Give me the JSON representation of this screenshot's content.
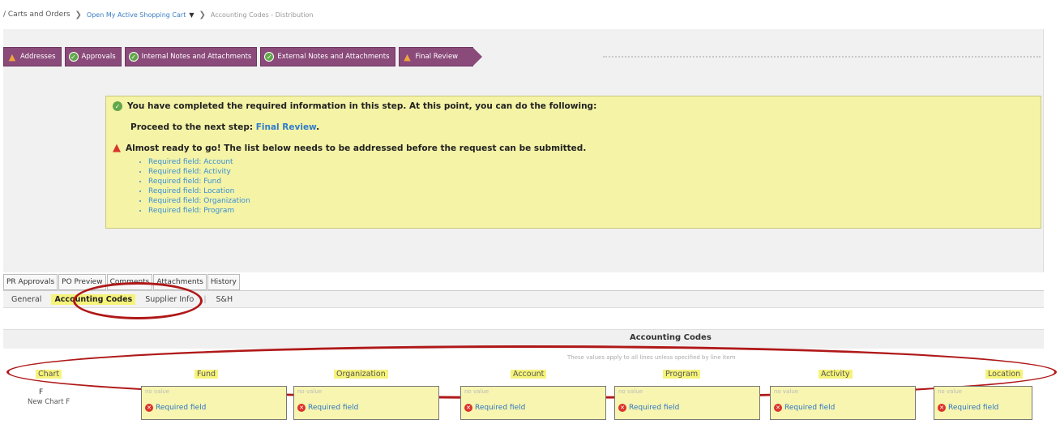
{
  "breadcrumb": {
    "part1": "/ Carts and Orders",
    "part2": "Open My Active Shopping Cart",
    "part3": "Accounting Codes",
    "part4": "Distribution"
  },
  "steps": [
    {
      "label": "Addresses",
      "status": "warning"
    },
    {
      "label": "Approvals",
      "status": "complete"
    },
    {
      "label": "Internal Notes and Attachments",
      "status": "complete"
    },
    {
      "label": "External Notes and Attachments",
      "status": "complete"
    },
    {
      "label": "Final Review",
      "status": "warning"
    }
  ],
  "notice": {
    "completed": "You have completed the required information in this step. At this point, you can do the following:",
    "proceed_prefix": "Proceed to the next step:",
    "proceed_link": "Final Review",
    "proceed_suffix": ".",
    "almost": "Almost ready to go! The list below needs to be addressed before the request can be submitted.",
    "required": [
      "Required field: Account",
      "Required field: Activity",
      "Required field: Fund",
      "Required field: Location",
      "Required field: Organization",
      "Required field: Program"
    ]
  },
  "tabs_top": [
    "PR Approvals",
    "PO Preview",
    "Comments",
    "Attachments",
    "History"
  ],
  "tabs_sub": {
    "general": "General",
    "accounting": "Accounting Codes",
    "supplier": "Supplier Info",
    "sh": "S&H"
  },
  "accounting": {
    "title": "Accounting Codes",
    "subtitle": "These values apply to all lines unless specified by line item",
    "columns": {
      "chart": "Chart",
      "fund": "Fund",
      "organization": "Organization",
      "account": "Account",
      "program": "Program",
      "activity": "Activity",
      "location": "Location"
    },
    "chart_value": "F",
    "chart_name": "New Chart F",
    "no_value": "no value",
    "required_label": "Required field"
  },
  "colors": {
    "step_bg": "#8a4a7a",
    "highlight": "#f6f37a",
    "notice_bg": "#f4f3a6",
    "annotation": "#b01818"
  }
}
